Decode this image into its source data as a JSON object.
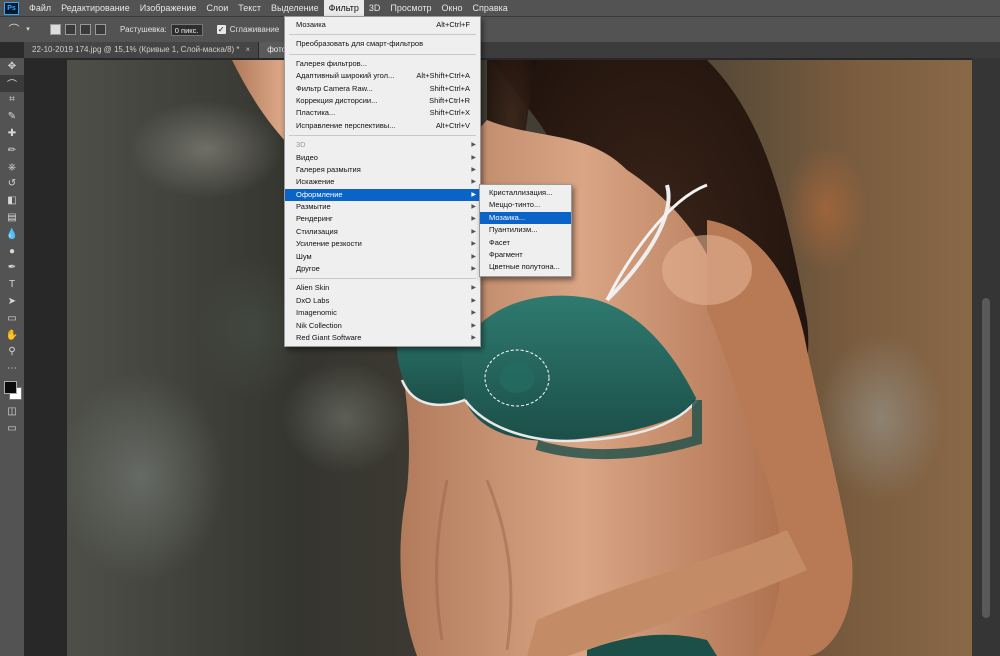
{
  "app": {
    "logo": "Ps"
  },
  "menubar": {
    "items": [
      "Файл",
      "Редактирование",
      "Изображение",
      "Слои",
      "Текст",
      "Выделение",
      "Фильтр",
      "3D",
      "Просмотр",
      "Окно",
      "Справка"
    ],
    "active_index": 6
  },
  "options": {
    "lasso_icon": "lasso-icon",
    "feather_label": "Растушевка:",
    "feather_value": "0 пикс.",
    "antialias_label": "Сглаживание",
    "antialias_checked": true
  },
  "tabs": [
    {
      "label": "22-10-2019 174.jpg @ 15,1% (Кривые 1, Слой-маска/8) *",
      "close": "×"
    },
    {
      "label": "фотосесс",
      "close": ""
    }
  ],
  "tools": [
    "move-tool-icon",
    "lasso-tool-icon",
    "crop-tool-icon",
    "eyedropper-tool-icon",
    "healing-brush-icon",
    "brush-tool-icon",
    "clone-stamp-icon",
    "history-brush-icon",
    "eraser-tool-icon",
    "gradient-tool-icon",
    "blur-tool-icon",
    "dodge-tool-icon",
    "pen-tool-icon",
    "type-tool-icon",
    "path-selection-icon",
    "rectangle-tool-icon",
    "hand-tool-icon",
    "zoom-tool-icon",
    "more-tools-icon"
  ],
  "filter_menu": {
    "sections": [
      [
        {
          "label": "Мозаика",
          "shortcut": "Alt+Ctrl+F"
        }
      ],
      [
        {
          "label": "Преобразовать для смарт-фильтров",
          "shortcut": ""
        }
      ],
      [
        {
          "label": "Галерея фильтров...",
          "shortcut": ""
        },
        {
          "label": "Адаптивный широкий угол...",
          "shortcut": "Alt+Shift+Ctrl+A"
        },
        {
          "label": "Фильтр Camera Raw...",
          "shortcut": "Shift+Ctrl+A"
        },
        {
          "label": "Коррекция дисторсии...",
          "shortcut": "Shift+Ctrl+R"
        },
        {
          "label": "Пластика...",
          "shortcut": "Shift+Ctrl+X"
        },
        {
          "label": "Исправление перспективы...",
          "shortcut": "Alt+Ctrl+V"
        }
      ],
      [
        {
          "label": "3D",
          "submenu": true,
          "disabled": true
        },
        {
          "label": "Видео",
          "submenu": true
        },
        {
          "label": "Галерея размытия",
          "submenu": true
        },
        {
          "label": "Искажение",
          "submenu": true
        },
        {
          "label": "Оформление",
          "submenu": true,
          "highlighted": true
        },
        {
          "label": "Размытие",
          "submenu": true
        },
        {
          "label": "Рендеринг",
          "submenu": true
        },
        {
          "label": "Стилизация",
          "submenu": true
        },
        {
          "label": "Усиление резкости",
          "submenu": true
        },
        {
          "label": "Шум",
          "submenu": true
        },
        {
          "label": "Другое",
          "submenu": true
        }
      ],
      [
        {
          "label": "Alien Skin",
          "submenu": true
        },
        {
          "label": "DxO Labs",
          "submenu": true
        },
        {
          "label": "Imagenomic",
          "submenu": true
        },
        {
          "label": "Nik Collection",
          "submenu": true
        },
        {
          "label": "Red Giant Software",
          "submenu": true
        }
      ]
    ]
  },
  "pixelate_submenu": {
    "items": [
      {
        "label": "Кристаллизация..."
      },
      {
        "label": "Меццо-тинто..."
      },
      {
        "label": "Мозаика...",
        "highlighted": true
      },
      {
        "label": "Пуантилизм..."
      },
      {
        "label": "Фасет"
      },
      {
        "label": "Фрагмент"
      },
      {
        "label": "Цветные полутона..."
      }
    ]
  },
  "colors": {
    "menu_highlight": "#0a64c8",
    "app_bg": "#535353",
    "foreground": "#0a0a0a",
    "background": "#ffffff"
  }
}
